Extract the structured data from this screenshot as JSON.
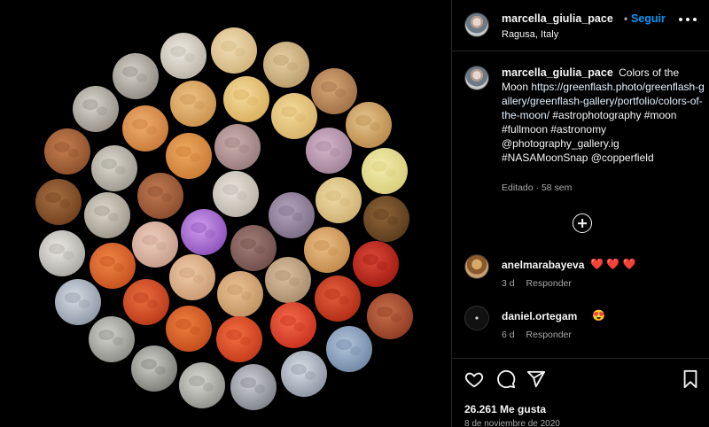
{
  "post": {
    "author": "marcella_giulia_pace",
    "separator": "•",
    "follow_label": "Seguir",
    "location": "Ragusa, Italy",
    "caption_user": "marcella_giulia_pace",
    "caption_text_1": "Colors of the Moon",
    "caption_link": "https://greenflash.photo/greenflash-gallery/greenflash-gallery/portfolio/colors-of-the-moon/",
    "caption_text_2": "#astrophotography #moon #fullmoon #astronomy @photography_gallery.ig #NASAMoonSnap @copperfield",
    "caption_meta": "Editado · 58 sem"
  },
  "comments": [
    {
      "user": "anelmarabayeva",
      "text": "❤️ ❤️ ❤️",
      "age": "3 d",
      "reply_label": "Responder"
    },
    {
      "user": "daniel.ortegam",
      "text": "😍",
      "age": "6 d",
      "reply_label": "Responder"
    }
  ],
  "actions": {
    "likes": "26.261 Me gusta",
    "date": "8 de noviembre de 2020"
  },
  "icons": {
    "more": "more-options-icon",
    "load_more": "plus-circle-icon",
    "like": "heart-icon",
    "comment": "comment-icon",
    "share": "share-icon",
    "save": "bookmark-icon"
  },
  "moons": [
    [
      "#b8b1a4",
      "#f0ece4"
    ],
    [
      "#d0b27a",
      "#f2e0b8"
    ],
    [
      "#b99a68",
      "#e8d2a6"
    ],
    [
      "#8e8a82",
      "#d8d4cc"
    ],
    [
      "#c8904a",
      "#f0c488"
    ],
    [
      "#d8ae5a",
      "#f5dca0"
    ],
    [
      "#9e6e44",
      "#d8a878"
    ],
    [
      "#948e84",
      "#dcd8d0"
    ],
    [
      "#c87838",
      "#f0b070"
    ],
    [
      "#d6b066",
      "#f4dc9c"
    ],
    [
      "#b88848",
      "#e6c690"
    ],
    [
      "#8a4e2a",
      "#c88050"
    ],
    [
      "#9a968c",
      "#e0dcd2"
    ],
    [
      "#c87a34",
      "#f0aa60"
    ],
    [
      "#967a7a",
      "#cfb2b0"
    ],
    [
      "#a08098",
      "#d8b8cc"
    ],
    [
      "#d6cc78",
      "#f4eeb0"
    ],
    [
      "#70401c",
      "#a87044"
    ],
    [
      "#9c9488",
      "#e0dad0"
    ],
    [
      "#8a4c2c",
      "#c27a54"
    ],
    [
      "#b8b0a6",
      "#ece6de"
    ],
    [
      "#7a6a84",
      "#b8a6c0"
    ],
    [
      "#cdb070",
      "#f0dca6"
    ],
    [
      "#5a3a1c",
      "#8e6638"
    ],
    [
      "#a8a6a0",
      "#eeece6"
    ],
    [
      "#c64e1c",
      "#f08848"
    ],
    [
      "#c49a88",
      "#f0d0c0"
    ],
    [
      "#8c50b8",
      "#d09ef0"
    ],
    [
      "#6e4c48",
      "#a4807a"
    ],
    [
      "#c08848",
      "#ecc088"
    ],
    [
      "#a01a10",
      "#de4a3a"
    ],
    [
      "#8c96a4",
      "#d8dee6"
    ],
    [
      "#b83818",
      "#ec7040"
    ],
    [
      "#c89870",
      "#f0cca8"
    ],
    [
      "#c09060",
      "#ecc494"
    ],
    [
      "#a88a6a",
      "#dcc2a0"
    ],
    [
      "#b02a14",
      "#e66040"
    ],
    [
      "#8e3a22",
      "#c8704c"
    ],
    [
      "#8a8a84",
      "#d6d6d0"
    ],
    [
      "#c04a1a",
      "#f08040"
    ],
    [
      "#c43818",
      "#f47044"
    ],
    [
      "#c8301c",
      "#f46a4c"
    ],
    [
      "#6e86a4",
      "#b4c6dc"
    ],
    [
      "#7a7a74",
      "#d2d2cc"
    ],
    [
      "#8e8e88",
      "#dcdcd6"
    ],
    [
      "#7e8088",
      "#d0d2d8"
    ],
    [
      "#8a92a0",
      "#dce2ea"
    ]
  ]
}
